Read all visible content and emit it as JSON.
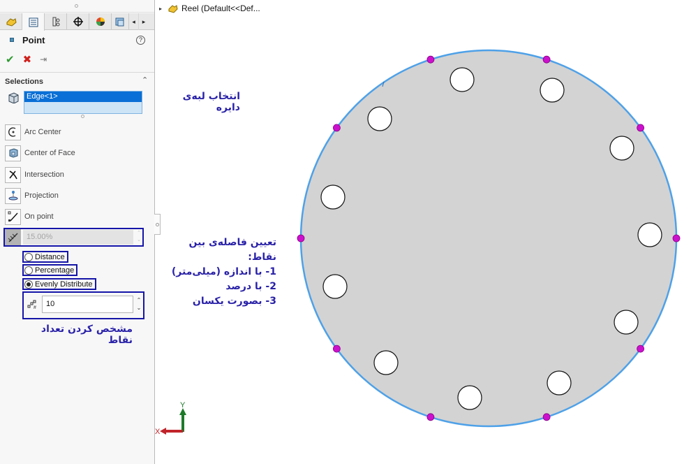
{
  "feature_tree": {
    "expand_icon": "triangle-right-icon",
    "part_icon": "part-icon",
    "label": "Reel  (Default<<Def..."
  },
  "panel": {
    "tabs": [
      {
        "name": "feature-manager",
        "icon": "part-icon"
      },
      {
        "name": "property-manager",
        "icon": "property-list-icon",
        "active": true
      },
      {
        "name": "configuration-manager",
        "icon": "configuration-icon"
      },
      {
        "name": "dimxpert-manager",
        "icon": "crosshair-icon"
      },
      {
        "name": "display-manager",
        "icon": "appearance-icon"
      },
      {
        "name": "cam-manager",
        "icon": "cam-icon"
      }
    ],
    "tab_scroll_left": "◂",
    "tab_scroll_right": "▸",
    "title": "Point",
    "help": "?",
    "actions": {
      "ok": "✔",
      "cancel": "✖",
      "pin": "⇥"
    },
    "selections": {
      "title": "Selections",
      "items": [
        "Edge<1>"
      ]
    },
    "reference_types": [
      {
        "label": "Arc Center",
        "icon": "arc-center-icon"
      },
      {
        "label": "Center of Face",
        "icon": "center-of-face-icon"
      },
      {
        "label": "Intersection",
        "icon": "intersection-icon"
      },
      {
        "label": "Projection",
        "icon": "projection-icon"
      },
      {
        "label": "On point",
        "icon": "on-point-icon"
      }
    ],
    "percentage_value": "15.00%",
    "spacing_options": [
      {
        "label": "Distance",
        "selected": false
      },
      {
        "label": "Percentage",
        "selected": false
      },
      {
        "label": "Evenly Distribute",
        "selected": true
      }
    ],
    "point_count": "10"
  },
  "annotations": {
    "select_edge": "انتخاب لبه‌ی دایره",
    "spacing_title": "تعیین فاصله‌ی بین نقاط:",
    "spacing_lines": [
      "1- با اندازه (میلی‌متر)",
      "2- با درصد",
      "3- بصورت یکسان"
    ],
    "count": "مشخص کردن تعداد نقاط"
  },
  "viewport": {
    "disk_fill": "#d3d3d3",
    "edge_color": "#4ea1e8",
    "point_color": "#cc11cc",
    "points_on_edge": 10,
    "holes": 11,
    "triad": {
      "x_label": "X",
      "y_label": "Y",
      "x_color": "#c0242a",
      "y_color": "#1e7a2a"
    }
  }
}
